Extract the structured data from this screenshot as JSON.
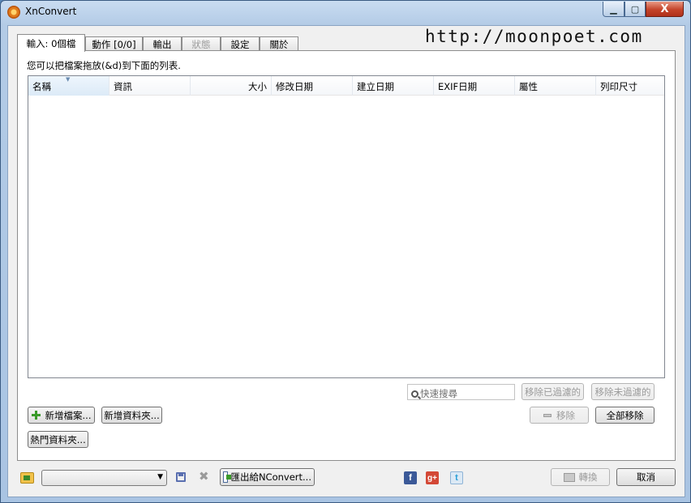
{
  "window": {
    "title": "XnConvert",
    "close_symbol": "X"
  },
  "tabs": [
    {
      "label": "輸入: 0個檔",
      "active": true,
      "enabled": true
    },
    {
      "label": "動作 [0/0]",
      "active": false,
      "enabled": true
    },
    {
      "label": "輸出",
      "active": false,
      "enabled": true
    },
    {
      "label": "狀態",
      "active": false,
      "enabled": false
    },
    {
      "label": "設定",
      "active": false,
      "enabled": true
    },
    {
      "label": "關於",
      "active": false,
      "enabled": true
    }
  ],
  "watermark": "http://moonpoet.com",
  "input_panel": {
    "hint": "您可以把檔案拖放(&d)到下面的列表.",
    "columns": [
      "名稱",
      "資訊",
      "大小",
      "修改日期",
      "建立日期",
      "EXIF日期",
      "屬性",
      "列印尺寸"
    ],
    "rows": [],
    "search_placeholder": "快速搜尋",
    "remove_filtered_label": "移除已過濾的",
    "remove_unfiltered_label": "移除未過濾的",
    "remove_label": "移除",
    "remove_all_label": "全部移除",
    "add_files_label": "新增檔案...",
    "add_folder_label": "新增資料夾...",
    "hot_folder_label": "熱門資料夾..."
  },
  "bottom_bar": {
    "preset_value": "",
    "export_label": "匯出給NConvert...",
    "social": {
      "facebook": "f",
      "gplus": "g+",
      "twitter": "t"
    },
    "convert_label": "轉換",
    "cancel_label": "取消"
  },
  "icons": {
    "app": "xnconvert-gear-icon",
    "search": "search-icon",
    "add": "plus-icon",
    "remove": "minus-icon",
    "folder": "folder-icon",
    "save": "save-icon",
    "delete": "delete-icon",
    "export": "export-icon"
  }
}
